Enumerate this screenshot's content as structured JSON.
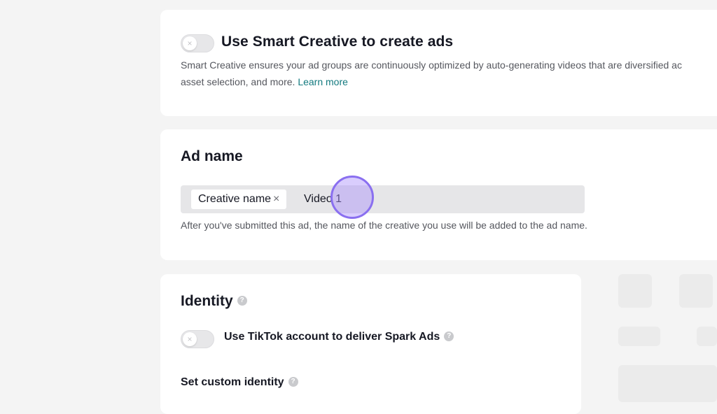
{
  "smart_creative": {
    "toggle_state": "off",
    "title": "Use Smart Creative to create ads",
    "description_line1": "Smart Creative ensures your ad groups are continuously optimized by auto-generating videos that are diversified ac",
    "description_line2": "asset selection, and more.",
    "learn_more": "Learn more"
  },
  "ad_name": {
    "title": "Ad name",
    "chip_label": "Creative name",
    "chip_remove": "×",
    "value": "Video 1",
    "hint": "After you've submitted this ad, the name of the creative you use will be added to the ad name."
  },
  "identity": {
    "title": "Identity",
    "help": "?",
    "spark_toggle_state": "off",
    "spark_label": "Use TikTok account to deliver Spark Ads",
    "custom_identity_label": "Set custom identity"
  },
  "icons": {
    "toggle_off": "×",
    "help": "question-circle-icon"
  },
  "colors": {
    "link": "#137a7f",
    "click_marker": "#8a6ff0",
    "background": "#f4f4f4"
  }
}
